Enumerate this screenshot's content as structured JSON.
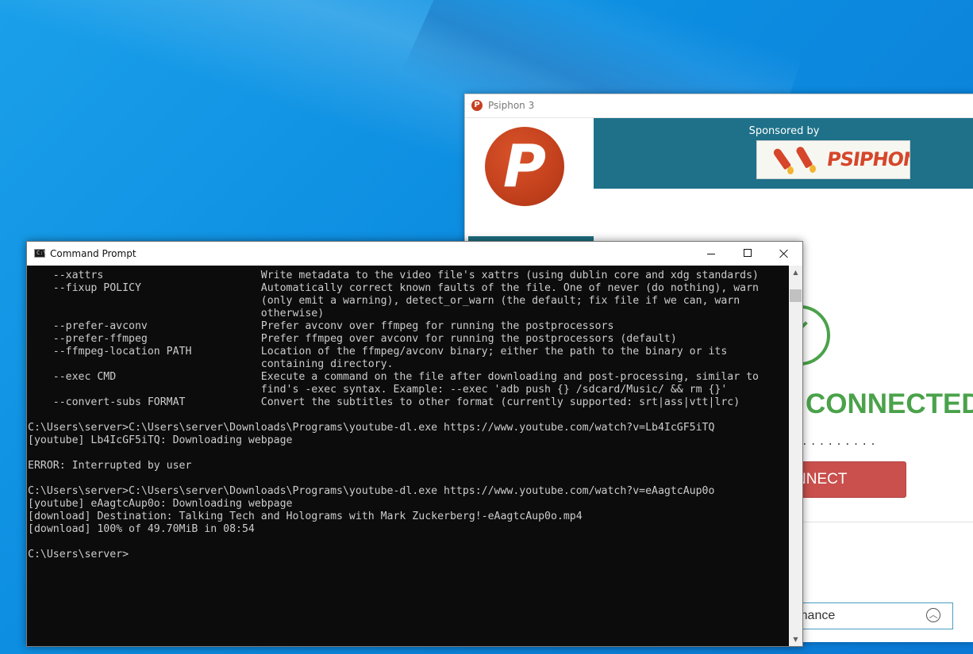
{
  "psiphon": {
    "title": "Psiphon 3",
    "logo_letter": "P",
    "sponsored_label": "Sponsored by",
    "sponsor_name": "PSIPHON",
    "status": "CONNECTED",
    "dots": "...........",
    "disconnect_label": "NNECT",
    "performance_label": "ormance",
    "brand_color": "#c2401c",
    "status_color": "#4aa24a"
  },
  "cmd": {
    "title": "Command Prompt",
    "lines": [
      "    --xattrs                         Write metadata to the video file's xattrs (using dublin core and xdg standards)",
      "    --fixup POLICY                   Automatically correct known faults of the file. One of never (do nothing), warn",
      "                                     (only emit a warning), detect_or_warn (the default; fix file if we can, warn",
      "                                     otherwise)",
      "    --prefer-avconv                  Prefer avconv over ffmpeg for running the postprocessors",
      "    --prefer-ffmpeg                  Prefer ffmpeg over avconv for running the postprocessors (default)",
      "    --ffmpeg-location PATH           Location of the ffmpeg/avconv binary; either the path to the binary or its",
      "                                     containing directory.",
      "    --exec CMD                       Execute a command on the file after downloading and post-processing, similar to",
      "                                     find's -exec syntax. Example: --exec 'adb push {} /sdcard/Music/ && rm {}'",
      "    --convert-subs FORMAT            Convert the subtitles to other format (currently supported: srt|ass|vtt|lrc)",
      "",
      "C:\\Users\\server>C:\\Users\\server\\Downloads\\Programs\\youtube-dl.exe https://www.youtube.com/watch?v=Lb4IcGF5iTQ",
      "[youtube] Lb4IcGF5iTQ: Downloading webpage",
      "",
      "ERROR: Interrupted by user",
      "",
      "C:\\Users\\server>C:\\Users\\server\\Downloads\\Programs\\youtube-dl.exe https://www.youtube.com/watch?v=eAagtcAup0o",
      "[youtube] eAagtcAup0o: Downloading webpage",
      "[download] Destination: Talking Tech and Holograms with Mark Zuckerberg!-eAagtcAup0o.mp4",
      "[download] 100% of 49.70MiB in 08:54",
      "",
      "C:\\Users\\server>"
    ]
  }
}
